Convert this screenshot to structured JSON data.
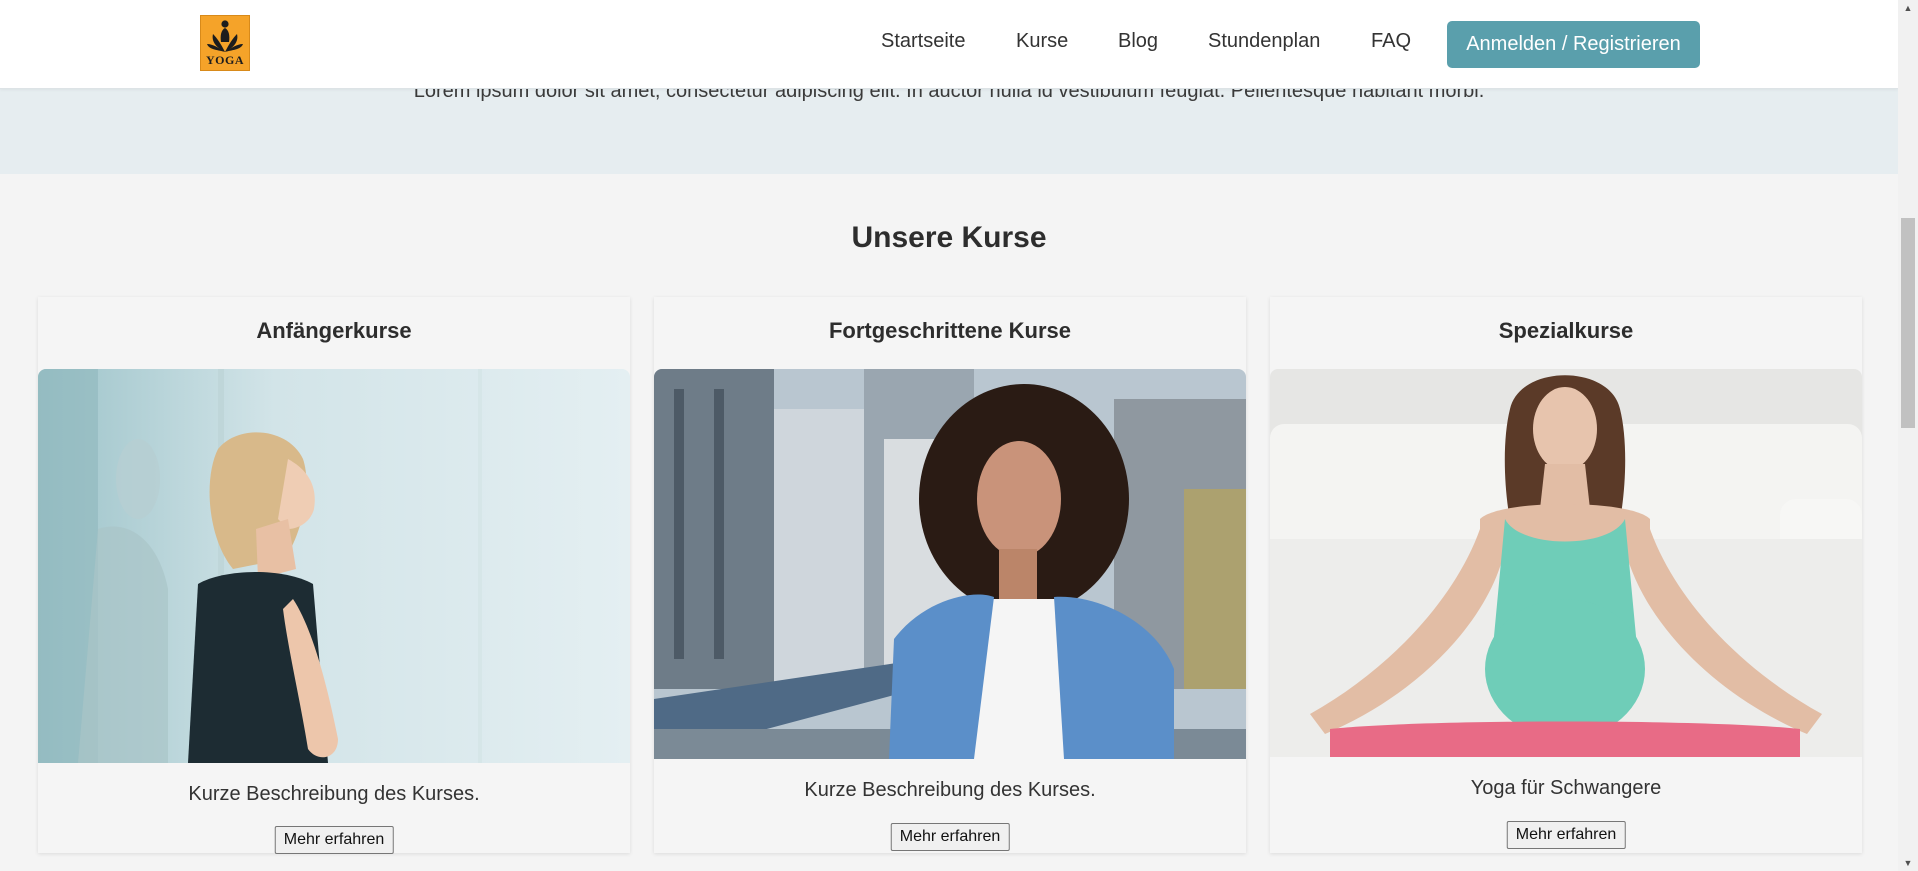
{
  "header": {
    "logo_text": "YOGA",
    "nav": [
      "Startseite",
      "Kurse",
      "Blog",
      "Stundenplan",
      "FAQ"
    ],
    "cta": "Anmelden / Registrieren"
  },
  "hero": {
    "text": "Lorem ipsum dolor sit amet, consectetur adipiscing elit. In auctor nulla id vestibulum feugiat. Pellentesque habitant morbi."
  },
  "courses": {
    "title": "Unsere Kurse",
    "cards": [
      {
        "title": "Anfängerkurse",
        "description": "Kurze Beschreibung des Kurses.",
        "button": "Mehr erfahren"
      },
      {
        "title": "Fortgeschrittene Kurse",
        "description": "Kurze Beschreibung des Kurses.",
        "button": "Mehr erfahren"
      },
      {
        "title": "Spezialkurse",
        "description": "Yoga für Schwangere",
        "button": "Mehr erfahren"
      }
    ]
  },
  "colors": {
    "accent": "#5a9fac",
    "logo_bg": "#f5a329",
    "hero_bg": "#e6edf0",
    "page_bg": "#f4f4f4"
  }
}
